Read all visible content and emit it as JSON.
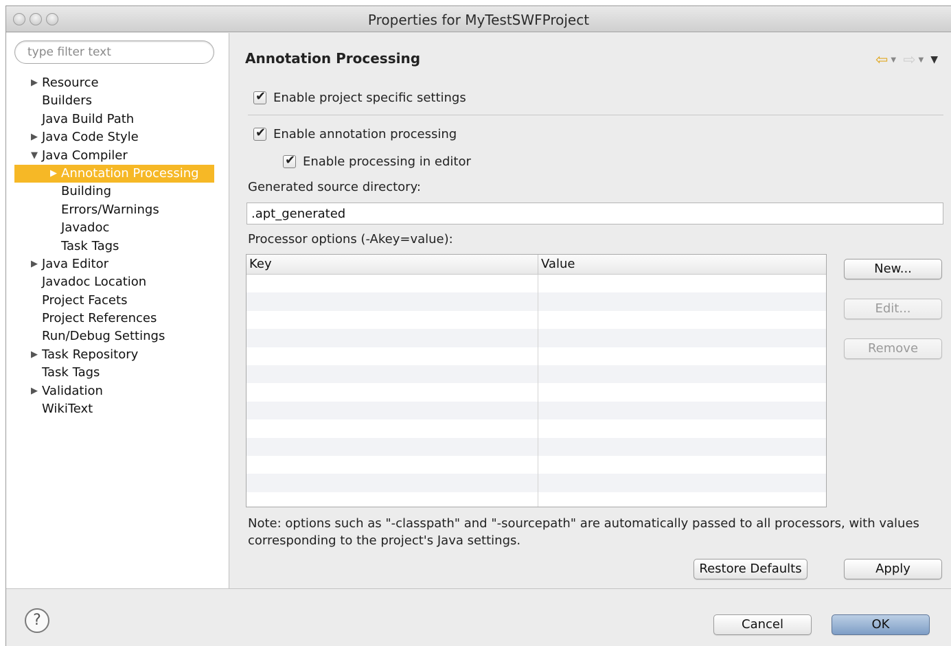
{
  "window": {
    "title": "Properties for MyTestSWFProject"
  },
  "sidebar": {
    "filter_placeholder": "type filter text",
    "items": [
      {
        "label": "Resource",
        "arrow": "▶",
        "indent": 0
      },
      {
        "label": "Builders",
        "arrow": "",
        "indent": 0
      },
      {
        "label": "Java Build Path",
        "arrow": "",
        "indent": 0
      },
      {
        "label": "Java Code Style",
        "arrow": "▶",
        "indent": 0
      },
      {
        "label": "Java Compiler",
        "arrow": "▼",
        "indent": 0
      },
      {
        "label": "Annotation Processing",
        "arrow": "▶",
        "indent": 1,
        "selected": true
      },
      {
        "label": "Building",
        "arrow": "",
        "indent": 1
      },
      {
        "label": "Errors/Warnings",
        "arrow": "",
        "indent": 1
      },
      {
        "label": "Javadoc",
        "arrow": "",
        "indent": 1
      },
      {
        "label": "Task Tags",
        "arrow": "",
        "indent": 1
      },
      {
        "label": "Java Editor",
        "arrow": "▶",
        "indent": 0
      },
      {
        "label": "Javadoc Location",
        "arrow": "",
        "indent": 0
      },
      {
        "label": "Project Facets",
        "arrow": "",
        "indent": 0
      },
      {
        "label": "Project References",
        "arrow": "",
        "indent": 0
      },
      {
        "label": "Run/Debug Settings",
        "arrow": "",
        "indent": 0
      },
      {
        "label": "Task Repository",
        "arrow": "▶",
        "indent": 0
      },
      {
        "label": "Task Tags",
        "arrow": "",
        "indent": 0
      },
      {
        "label": "Validation",
        "arrow": "▶",
        "indent": 0
      },
      {
        "label": "WikiText",
        "arrow": "",
        "indent": 0
      }
    ],
    "selected_color": "#f6b826"
  },
  "page": {
    "header": "Annotation Processing",
    "nav": {
      "back_icon": "back-arrow-icon",
      "forward_icon": "forward-arrow-icon",
      "menu_icon": "view-menu-icon"
    },
    "enable_project_specific": {
      "label": "Enable project specific settings",
      "checked": true
    },
    "enable_annotation_processing": {
      "label": "Enable annotation processing",
      "checked": true
    },
    "enable_processing_in_editor": {
      "label": "Enable processing in editor",
      "checked": true
    },
    "generated_source_label": "Generated source directory:",
    "generated_source_value": ".apt_generated",
    "processor_options_label": "Processor options (-Akey=value):",
    "table": {
      "columns": [
        "Key",
        "Value"
      ],
      "rows": []
    },
    "buttons": {
      "new": "New...",
      "edit": "Edit...",
      "remove": "Remove"
    },
    "note": "Note: options such as \"-classpath\" and \"-sourcepath\" are automatically passed to all processors, with values corresponding to the project's Java settings.",
    "restore_defaults": "Restore Defaults",
    "apply": "Apply"
  },
  "footer": {
    "help_icon": "help-icon",
    "help_glyph": "?",
    "cancel": "Cancel",
    "ok": "OK"
  }
}
